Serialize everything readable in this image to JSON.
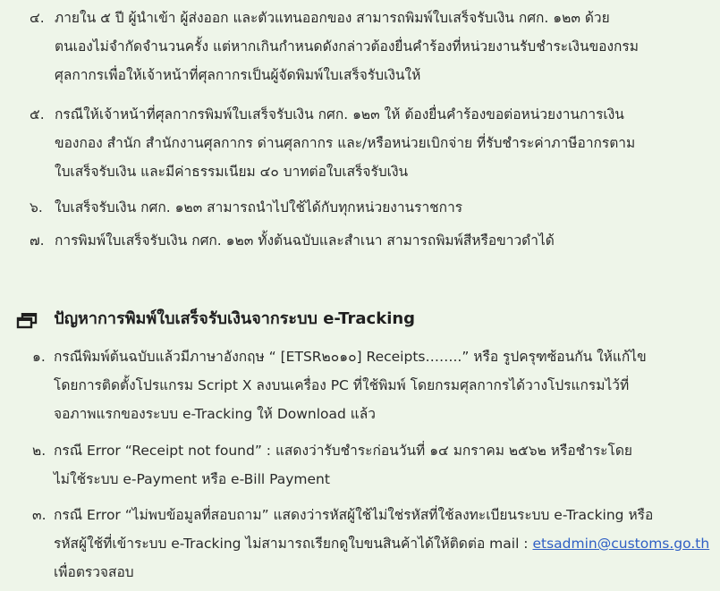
{
  "upper_list": [
    {
      "num": "๔.",
      "lines": [
        "ภายใน ๕ ปี ผู้นำเข้า ผู้ส่งออก และตัวแทนออกของ สามารถพิมพ์ใบเสร็จรับเงิน กศก. ๑๒๓ ด้วย",
        "ตนเองไม่จำกัดจำนวนครั้ง แต่หากเกินกำหนดดังกล่าวต้องยื่นคำร้องที่หน่วยงานรับชำระเงินของกรม",
        "ศุลกากรเพื่อให้เจ้าหน้าที่ศุลกากรเป็นผู้จัดพิมพ์ใบเสร็จรับเงินให้"
      ]
    },
    {
      "num": "๕.",
      "lines": [
        "กรณีให้เจ้าหน้าที่ศุลกากรพิมพ์ใบเสร็จรับเงิน กศก. ๑๒๓ ให้ ต้องยื่นคำร้องขอต่อหน่วยงานการเงิน",
        "ของกอง สำนัก สำนักงานศุลกากร ด่านศุลกากร และ/หรือหน่วยเบิกจ่าย ที่รับชำระค่าภาษีอากรตาม",
        "ใบเสร็จรับเงิน และมีค่าธรรมเนียม ๔๐ บาทต่อใบเสร็จรับเงิน"
      ]
    },
    {
      "num": "๖.",
      "lines": [
        "ใบเสร็จรับเงิน กศก. ๑๒๓ สามารถนำไปใช้ได้กับทุกหน่วยงานราชการ"
      ]
    },
    {
      "num": "๗.",
      "lines": [
        "การพิมพ์ใบเสร็จรับเงิน กศก. ๑๒๓ ทั้งต้นฉบับและสำเนา สามารถพิมพ์สีหรือขาวดำได้"
      ]
    }
  ],
  "section": {
    "icon": "window-restore-icon",
    "title": "ปัญหาการพิมพ์ใบเสร็จรับเงินจากระบบ e-Tracking"
  },
  "problems": [
    {
      "num": "๑.",
      "lines": [
        "กรณีพิมพ์ต้นฉบับแล้วมีภาษาอังกฤษ “ [ETSR๒๐๑๐] Receipts……..” หรือ รูปครุฑซ้อนกัน ให้แก้ไข",
        "โดยการติดตั้งโปรแกรม Script X ลงบนเครื่อง PC ที่ใช้พิมพ์ โดยกรมศุลกากรได้วางโปรแกรมไว้ที่",
        "จอภาพแรกของระบบ e-Tracking ให้ Download แล้ว"
      ]
    },
    {
      "num": "๒.",
      "lines": [
        "กรณี Error “Receipt not found” : แสดงว่ารับชำระก่อนวันที่ ๑๔ มกราคม ๒๕๖๒ หรือชำระโดย",
        "ไม่ใช้ระบบ e-Payment หรือ e-Bill Payment"
      ]
    },
    {
      "num": "๓.",
      "lines": [
        "กรณี Error “ไม่พบข้อมูลที่สอบถาม” แสดงว่ารหัสผู้ใช้ไม่ใช่รหัสที่ใช้ลงทะเบียนระบบ e-Tracking หรือ",
        "รหัสผู้ใช้ที่เข้าระบบ e-Tracking ไม่สามารถเรียกดูใบขนสินค้าได้ให้ติดต่อ mail : ",
        "เพื่อตรวจสอบ"
      ],
      "email": "etsadmin@customs.go.th"
    }
  ],
  "colors": {
    "background": "#eef5e9",
    "text": "#2a2a2a",
    "link": "#2f5fc4"
  }
}
